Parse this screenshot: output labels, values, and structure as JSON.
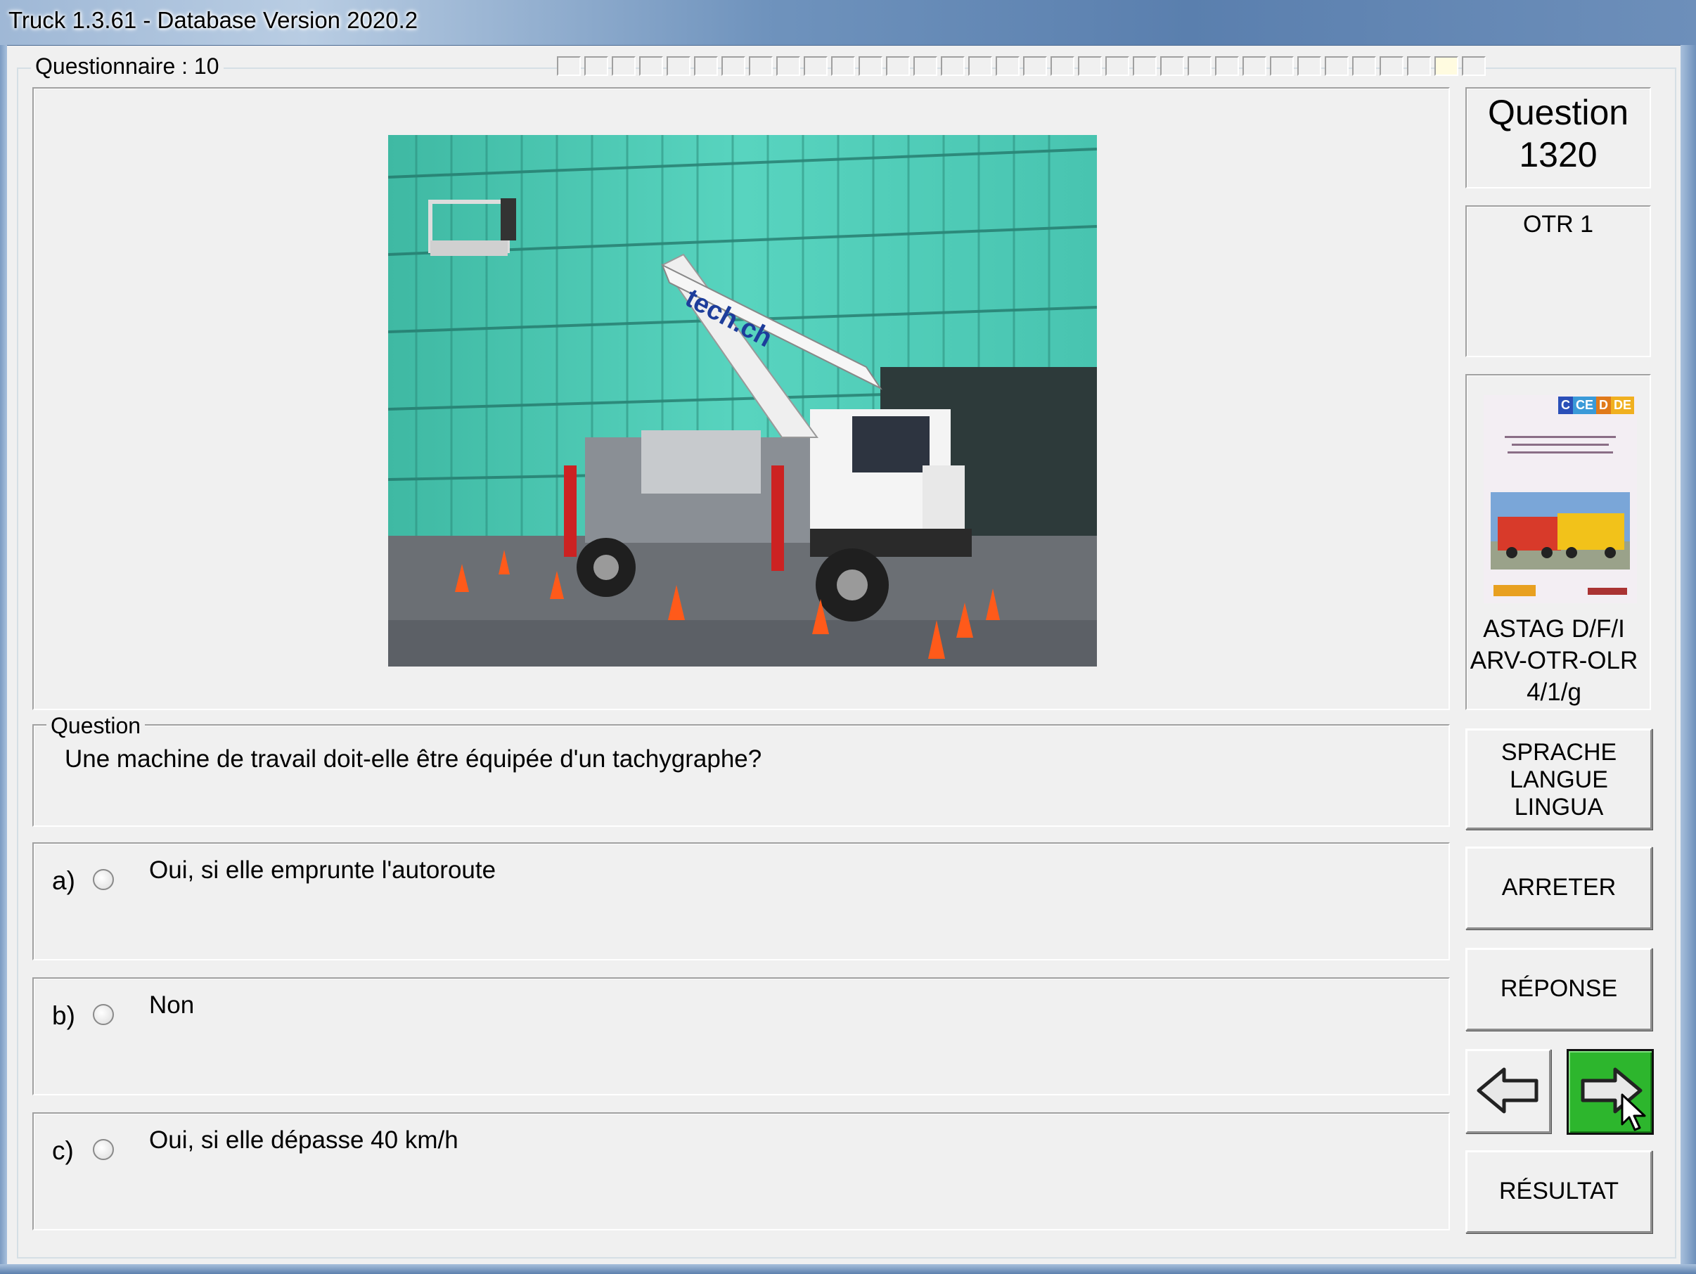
{
  "window": {
    "title": "Truck 1.3.61 - Database Version 2020.2"
  },
  "questionnaire": {
    "label": "Questionnaire : 10",
    "segments": 34,
    "current_index": 32
  },
  "question_panel": {
    "number_label": "Question",
    "number": "1320",
    "category": "OTR 1",
    "caption": "Question",
    "text": "Une machine de travail doit-elle être équipée d'un tachygraphe?"
  },
  "image": {
    "description_icon": "aerial-work-platform-truck-photo",
    "brand_text": "tech.ch"
  },
  "answers": [
    {
      "letter": "a)",
      "text": "Oui, si elle emprunte l'autoroute"
    },
    {
      "letter": "b)",
      "text": "Non"
    },
    {
      "letter": "c)",
      "text": "Oui, si elle dépasse 40 km/h"
    }
  ],
  "book": {
    "badges": [
      "C",
      "CE",
      "D",
      "DE"
    ],
    "line1": "ASTAG D/F/I",
    "line2": "ARV-OTR-OLR",
    "line3": "4/1/g"
  },
  "buttons": {
    "language": [
      "SPRACHE",
      "LANGUE",
      "LINGUA"
    ],
    "stop": "ARRETER",
    "answer": "RÉPONSE",
    "result": "RÉSULTAT",
    "prev_icon": "left-arrow-icon",
    "next_icon": "right-arrow-icon"
  },
  "colors": {
    "next_button": "#2db62d",
    "title_gradient": "#6f93bd",
    "window_bg": "#f0f0f0"
  }
}
